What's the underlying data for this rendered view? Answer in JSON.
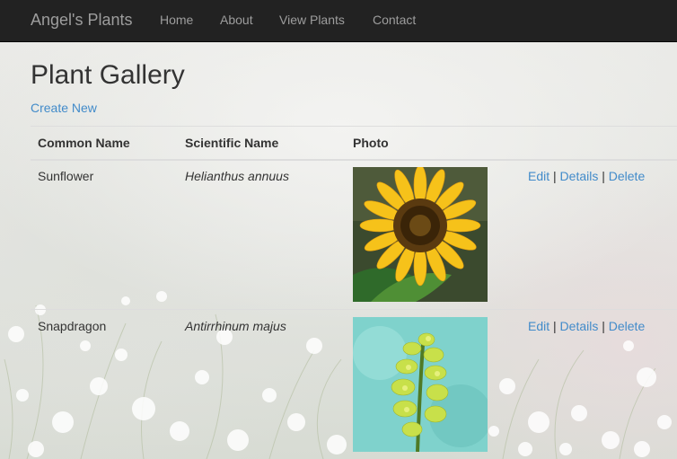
{
  "nav": {
    "brand": "Angel's Plants",
    "links": [
      "Home",
      "About",
      "View Plants",
      "Contact"
    ]
  },
  "page": {
    "title": "Plant Gallery",
    "create_new": "Create New"
  },
  "table": {
    "headers": [
      "Common Name",
      "Scientific Name",
      "Photo"
    ],
    "rows": [
      {
        "common_name": "Sunflower",
        "scientific_name": "Helianthus annuus",
        "photo_icon": "sunflower-photo",
        "actions": [
          "Edit",
          "Details",
          "Delete"
        ],
        "separator": "|"
      },
      {
        "common_name": "Snapdragon",
        "scientific_name": "Antirrhinum majus",
        "photo_icon": "snapdragon-photo",
        "actions": [
          "Edit",
          "Details",
          "Delete"
        ],
        "separator": "|"
      }
    ]
  },
  "colors": {
    "navbar": "#222222",
    "nav_text": "#9d9d9d",
    "link": "#428bca"
  }
}
